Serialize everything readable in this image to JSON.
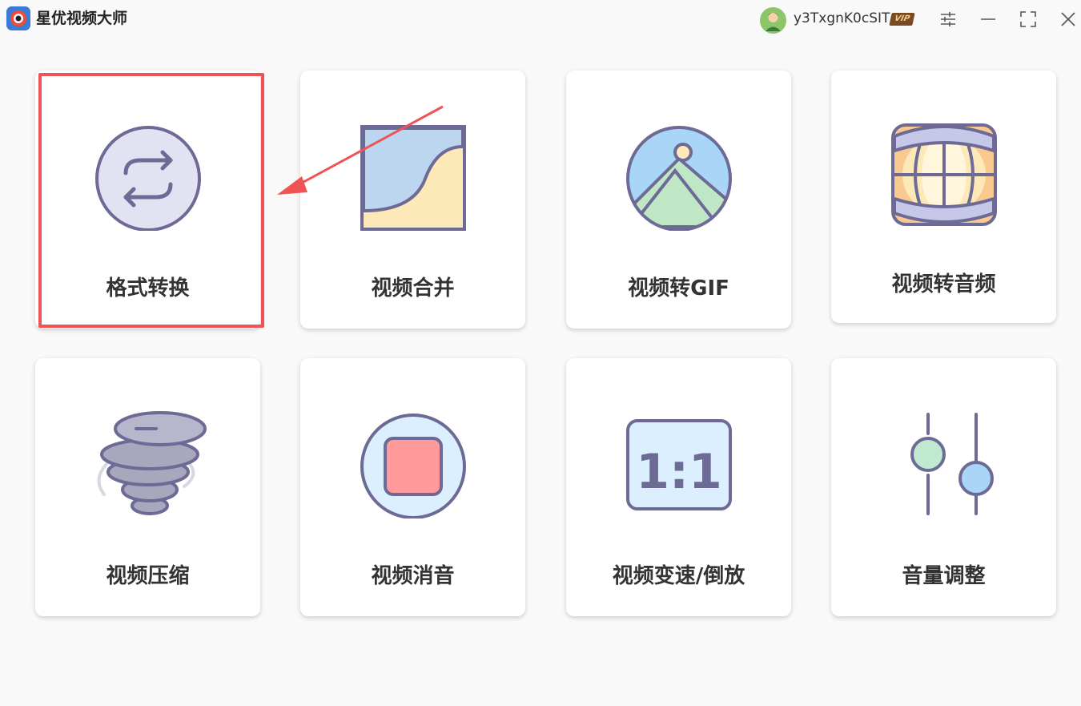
{
  "app": {
    "title": "星优视频大师",
    "logo_icon": "camera-eye-icon"
  },
  "user": {
    "name": "y3TxgnK0cSIT",
    "badge": "VIP"
  },
  "window_controls": {
    "settings_icon": "sliders-icon",
    "minimize_icon": "minimize-icon",
    "maximize_icon": "maximize-icon",
    "close_icon": "close-icon"
  },
  "tools": [
    {
      "label": "格式转换",
      "icon": "convert-icon"
    },
    {
      "label": "视频合并",
      "icon": "merge-icon"
    },
    {
      "label": "视频转GIF",
      "icon": "image-gif-icon"
    },
    {
      "label": "视频转音频",
      "icon": "globe-audio-icon"
    },
    {
      "label": "视频压缩",
      "icon": "tornado-compress-icon"
    },
    {
      "label": "视频消音",
      "icon": "stop-mute-icon"
    },
    {
      "label": "视频变速/倒放",
      "icon": "ratio-1-1-icon"
    },
    {
      "label": "音量调整",
      "icon": "volume-sliders-icon"
    }
  ],
  "ratio_text": "1:1",
  "colors": {
    "highlight": "#f05353",
    "icon_stroke": "#6e6a96",
    "accent_blue": "#3a7bd5"
  }
}
